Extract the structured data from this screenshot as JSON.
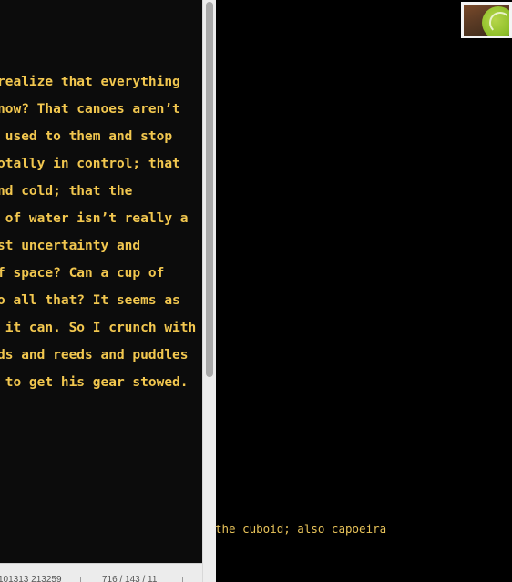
{
  "editor": {
    "lines": [
      "realize that everything",
      "now? That canoes aren’t",
      " used to them and stop",
      "otally in control; that",
      "nd cold; that the",
      " of water isn’t really a",
      "st uncertainty and",
      "f space? Can a cup of",
      "o all that? It seems as",
      " it can. So I crunch with",
      "ds and reeds and puddles",
      " to get his gear stowed."
    ],
    "text_color": "#f2c74f",
    "background": "#0c0c0c"
  },
  "status": {
    "position": "101313 213259",
    "count": "716 / 143 / 11"
  },
  "canvas": {
    "caption": "the cuboid; also capoeira",
    "caption_color": "#e8c35a",
    "thumbnail_icon": "tennis-ball-image"
  }
}
